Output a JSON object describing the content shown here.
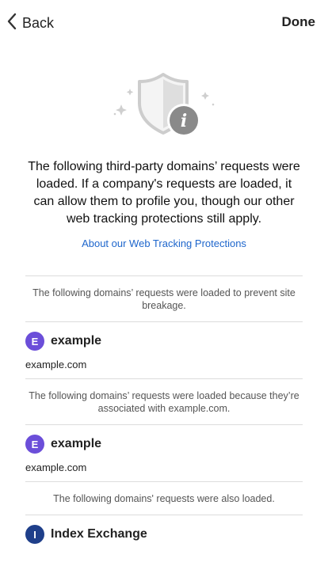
{
  "nav": {
    "back_label": "Back",
    "done_label": "Done"
  },
  "intro": {
    "text": "The following third-party domains’ requests were loaded. If a company's requests are loaded, it can allow them to profile you, though our other web tracking protections still apply."
  },
  "link": {
    "text": "About our Web Tracking Protections"
  },
  "sections": [
    {
      "header": "The following domains’ requests were loaded to prevent site breakage.",
      "domains": [
        {
          "initial": "E",
          "name": "example",
          "url": "example.com",
          "color": "#6b4ed9"
        }
      ]
    },
    {
      "header": "The following domains’ requests were loaded because they’re associated with example.com.",
      "domains": [
        {
          "initial": "E",
          "name": "example",
          "url": "example.com",
          "color": "#6b4ed9"
        }
      ]
    },
    {
      "header": "The following domains' requests were also loaded.",
      "domains": [
        {
          "initial": "I",
          "name": "Index Exchange",
          "url": "",
          "color": "#1f3f8a"
        }
      ]
    }
  ],
  "icons": {
    "back": "chevron-left-icon",
    "hero": "shield-info-icon"
  },
  "colors": {
    "link": "#1e66cc",
    "badge_e": "#6b4ed9",
    "badge_i": "#1f3f8a",
    "info_circle": "#8a8a8a"
  }
}
